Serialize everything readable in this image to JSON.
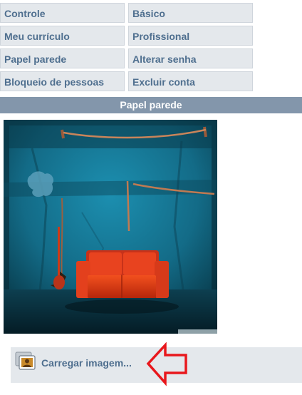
{
  "menu": {
    "items": [
      {
        "label": "Controle"
      },
      {
        "label": "Básico"
      },
      {
        "label": "Meu currículo"
      },
      {
        "label": "Profissional"
      },
      {
        "label": "Papel parede"
      },
      {
        "label": "Alterar senha"
      },
      {
        "label": "Bloqueio de pessoas"
      },
      {
        "label": "Excluir conta"
      }
    ]
  },
  "section": {
    "title": "Papel parede"
  },
  "upload": {
    "label": "Carregar imagem..."
  },
  "colors": {
    "menu_bg": "#e4e8ec",
    "menu_text": "#4f6f8f",
    "section_bar": "#8396ab",
    "arrow": "#e8171c"
  }
}
